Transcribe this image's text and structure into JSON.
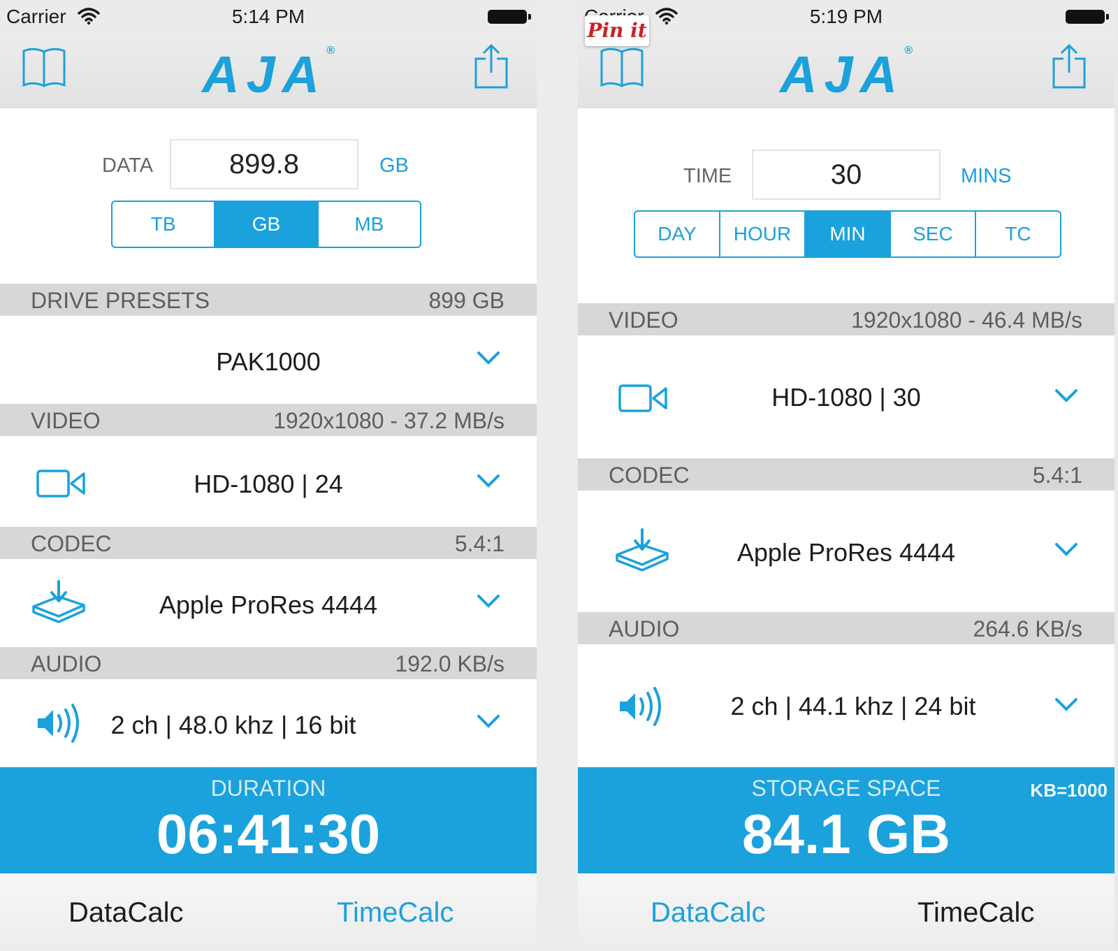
{
  "left": {
    "status": {
      "carrier": "Carrier",
      "time": "5:14 PM"
    },
    "logo": "AJA",
    "input": {
      "label": "DATA",
      "value": "899.8",
      "unit": "GB"
    },
    "units": [
      {
        "label": "TB"
      },
      {
        "label": "GB",
        "selected": true
      },
      {
        "label": "MB"
      }
    ],
    "drive": {
      "header": "DRIVE PRESETS",
      "header_value": "899 GB",
      "value": "PAK1000"
    },
    "video": {
      "header": "VIDEO",
      "header_value": "1920x1080 - 37.2 MB/s",
      "value": "HD-1080  |  24"
    },
    "codec": {
      "header": "CODEC",
      "header_value": "5.4:1",
      "value": "Apple ProRes 4444"
    },
    "audio": {
      "header": "AUDIO",
      "header_value": "192.0 KB/s",
      "value": "2 ch  |  48.0 khz  |  16 bit"
    },
    "result": {
      "label": "DURATION",
      "value": "06:41:30"
    },
    "tabs": {
      "datacalc": "DataCalc",
      "timecalc": "TimeCalc",
      "active": "datacalc"
    }
  },
  "right": {
    "status": {
      "carrier": "Carrier",
      "time": "5:19 PM"
    },
    "pin_label": "Pin it",
    "logo": "AJA",
    "input": {
      "label": "TIME",
      "value": "30",
      "unit": "MINS"
    },
    "units": [
      {
        "label": "DAY"
      },
      {
        "label": "HOUR"
      },
      {
        "label": "MIN",
        "selected": true
      },
      {
        "label": "SEC"
      },
      {
        "label": "TC"
      }
    ],
    "video": {
      "header": "VIDEO",
      "header_value": "1920x1080 - 46.4 MB/s",
      "value": "HD-1080  |  30"
    },
    "codec": {
      "header": "CODEC",
      "header_value": "5.4:1",
      "value": "Apple ProRes 4444"
    },
    "audio": {
      "header": "AUDIO",
      "header_value": "264.6 KB/s",
      "value": "2 ch  |  44.1 khz  |  24 bit"
    },
    "result": {
      "label": "STORAGE SPACE",
      "value": "84.1 GB",
      "note": "KB=1000"
    },
    "tabs": {
      "datacalc": "DataCalc",
      "timecalc": "TimeCalc",
      "active": "timecalc"
    }
  },
  "icons": [
    "wifi-icon",
    "battery-icon",
    "book-icon",
    "share-icon",
    "video-camera-icon",
    "disk-download-icon",
    "speaker-icon",
    "chevron-down-icon"
  ],
  "colors": {
    "accent": "#1ba1db",
    "section_header": "#d7d7d7",
    "pin_red": "#cb2027"
  }
}
